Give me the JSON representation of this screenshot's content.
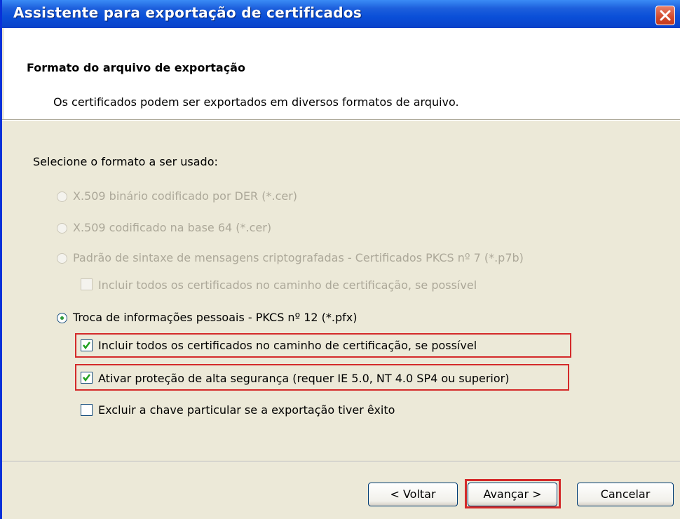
{
  "window": {
    "title": "Assistente para exportação de certificados"
  },
  "header": {
    "title": "Formato do arquivo de exportação",
    "subtitle": "Os certificados podem ser exportados em diversos formatos de arquivo."
  },
  "body": {
    "prompt": "Selecione o formato a ser usado:",
    "options": [
      {
        "label": "X.509 binário codificado por DER (*.cer)",
        "enabled": false,
        "selected": false
      },
      {
        "label": "X.509 codificado na base 64 (*.cer)",
        "enabled": false,
        "selected": false
      },
      {
        "label": "Padrão de sintaxe de mensagens criptografadas - Certificados PKCS nº 7 (*.p7b)",
        "enabled": false,
        "selected": false
      },
      {
        "label": "Troca de informações pessoais - PKCS nº 12 (*.pfx)",
        "enabled": true,
        "selected": true
      }
    ],
    "p7b_include_all": {
      "label": "Incluir todos os certificados no caminho de certificação, se possível",
      "checked": false,
      "enabled": false
    },
    "pfx_include_all": {
      "label": "Incluir todos os certificados no caminho de certificação, se possível",
      "checked": true
    },
    "pfx_high_security": {
      "label": "Ativar proteção de alta segurança (requer IE 5.0, NT 4.0 SP4 ou superior)",
      "checked": true
    },
    "pfx_delete_key": {
      "label": "Excluir a chave particular se a exportação tiver êxito",
      "checked": false
    }
  },
  "buttons": {
    "back": "< Voltar",
    "next": "Avançar >",
    "cancel": "Cancelar"
  },
  "colors": {
    "titlebar": "#0a4fd8",
    "highlight": "#d42a2a",
    "dialog_bg": "#ece9d8"
  }
}
